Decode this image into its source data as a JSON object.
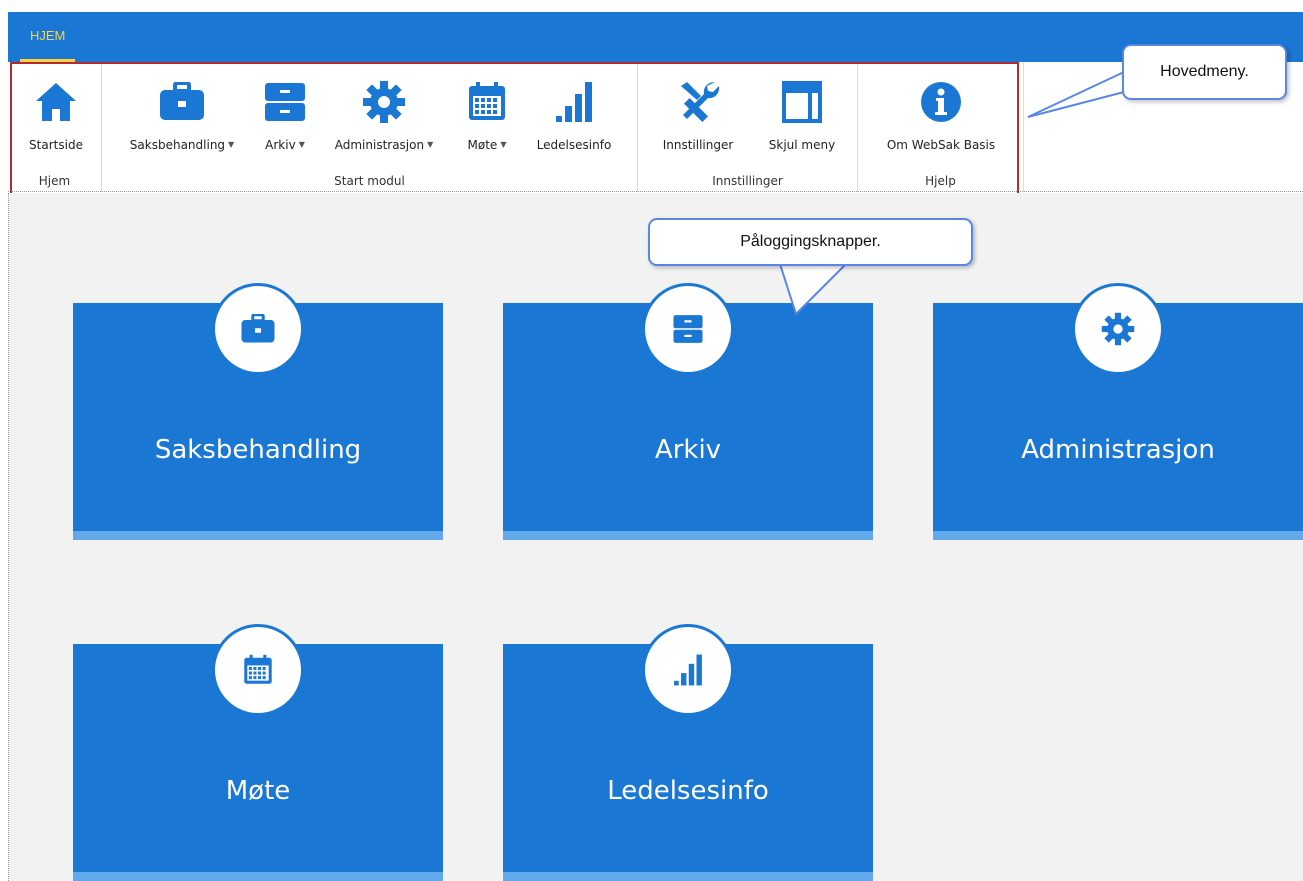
{
  "tabs": [
    {
      "label": "HJEM",
      "active": true
    }
  ],
  "ribbon": {
    "groups": [
      {
        "label": "Hjem",
        "buttons": [
          {
            "label": "Startside",
            "icon": "home-icon"
          }
        ]
      },
      {
        "label": "Start modul",
        "buttons": [
          {
            "label": "Saksbehandling",
            "icon": "briefcase-icon",
            "dropdown": true
          },
          {
            "label": "Arkiv",
            "icon": "archive-icon",
            "dropdown": true
          },
          {
            "label": "Administrasjon",
            "icon": "gear-icon",
            "dropdown": true
          },
          {
            "label": "Møte",
            "icon": "calendar-icon",
            "dropdown": true
          },
          {
            "label": "Ledelsesinfo",
            "icon": "bar-chart-icon",
            "dropdown": false
          }
        ]
      },
      {
        "label": "Innstillinger",
        "buttons": [
          {
            "label": "Innstillinger",
            "icon": "tools-icon"
          },
          {
            "label": "Skjul meny",
            "icon": "layout-icon"
          }
        ]
      },
      {
        "label": "Hjelp",
        "buttons": [
          {
            "label": "Om WebSak Basis",
            "icon": "info-icon"
          }
        ]
      }
    ]
  },
  "callouts": {
    "main_menu": "Hovedmeny.",
    "login_buttons": "Påloggingsknapper."
  },
  "tiles": [
    {
      "label": "Saksbehandling",
      "icon": "briefcase-icon"
    },
    {
      "label": "Arkiv",
      "icon": "archive-icon"
    },
    {
      "label": "Administrasjon",
      "icon": "gear-icon"
    },
    {
      "label": "Møte",
      "icon": "calendar-icon"
    },
    {
      "label": "Ledelsesinfo",
      "icon": "bar-chart-icon"
    }
  ],
  "colors": {
    "primary": "#1a77d4",
    "tile_bar": "#64a8ec",
    "tab_active": "#ffd24a",
    "highlight": "#b22b2b",
    "callout_border": "#5a86e6"
  }
}
